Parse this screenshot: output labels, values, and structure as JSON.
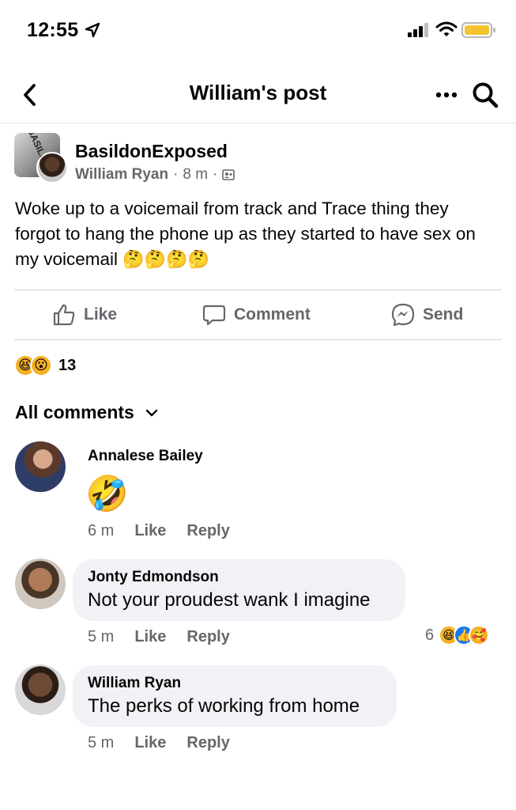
{
  "status_bar": {
    "time": "12:55",
    "icons": [
      "location-arrow-icon",
      "signal-icon",
      "wifi-icon",
      "battery-icon"
    ]
  },
  "nav": {
    "title": "William's post",
    "back_icon": "chevron-left-icon",
    "more_icon": "more-dots-icon",
    "search_icon": "search-icon"
  },
  "post": {
    "group_name": "BasildonExposed",
    "author": "William Ryan",
    "time": "8 m",
    "separator": "·",
    "group_logo_text": "BASILDON",
    "text": "Woke up to a voicemail from track and Trace thing they forgot to hang the phone up as they started to have sex on my voicemail",
    "emojis": "🤔🤔🤔🤔"
  },
  "actions": {
    "like": "Like",
    "comment": "Comment",
    "send": "Send"
  },
  "reactions": {
    "count": "13",
    "types": [
      "haha",
      "wow"
    ],
    "haha_glyph": "😆",
    "wow_glyph": "😮"
  },
  "comments_filter": {
    "label": "All comments"
  },
  "comments": [
    {
      "name": "Annalese Bailey",
      "text": "🤣",
      "time": "6 m",
      "like": "Like",
      "reply": "Reply"
    },
    {
      "name": "Jonty Edmondson",
      "text": "Not your proudest wank I imagine",
      "time": "5 m",
      "like": "Like",
      "reply": "Reply",
      "reaction_count": "6",
      "reaction_glyphs": [
        "😆",
        "👍",
        "🥰"
      ]
    },
    {
      "name": "William Ryan",
      "text": "The perks of working from home",
      "time": "5 m",
      "like": "Like",
      "reply": "Reply"
    }
  ],
  "colors": {
    "text_primary": "#050505",
    "text_secondary": "#65676b",
    "bubble_bg": "#f0f2f5",
    "divider": "#ced0d4",
    "battery": "#f4c430",
    "like_blue": "#1877f2"
  }
}
